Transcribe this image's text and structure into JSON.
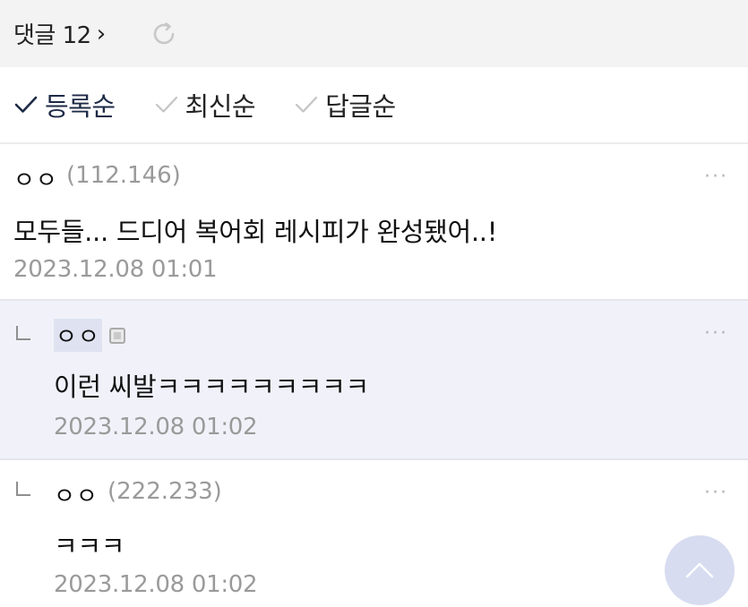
{
  "header": {
    "title": "댓글 12",
    "chevron": "›",
    "refresh_icon": "refresh-icon"
  },
  "sort": {
    "options": [
      {
        "label": "등록순",
        "active": true
      },
      {
        "label": "최신순",
        "active": false
      },
      {
        "label": "답글순",
        "active": false
      }
    ]
  },
  "comments": [
    {
      "nickname": "ㅇㅇ",
      "ip": "(112.146)",
      "text": "모두들... 드디어 복어회 레시피가 완성됐어..!",
      "date": "2023.12.08 01:01",
      "more": "···",
      "is_reply": false
    },
    {
      "nickname": "ㅇㅇ",
      "ip": "",
      "text": "이런 씨발ㅋㅋㅋㅋㅋㅋㅋㅋㅋ",
      "date": "2023.12.08 01:02",
      "more": "···",
      "is_reply": true,
      "badge": "member-badge-icon"
    },
    {
      "nickname": "ㅇㅇ",
      "ip": "(222.233)",
      "text": "ㅋㅋㅋ",
      "date": "2023.12.08 01:02",
      "more": "···",
      "is_reply": true
    }
  ],
  "colors": {
    "topbar_bg": "#f3f3f3",
    "reply_bg": "#f1f2f9",
    "active_check": "#1d2a46",
    "inactive_check": "#c4c4c4",
    "meta_gray": "#9a9a9a",
    "scroll_button": "#d7dcf0"
  }
}
